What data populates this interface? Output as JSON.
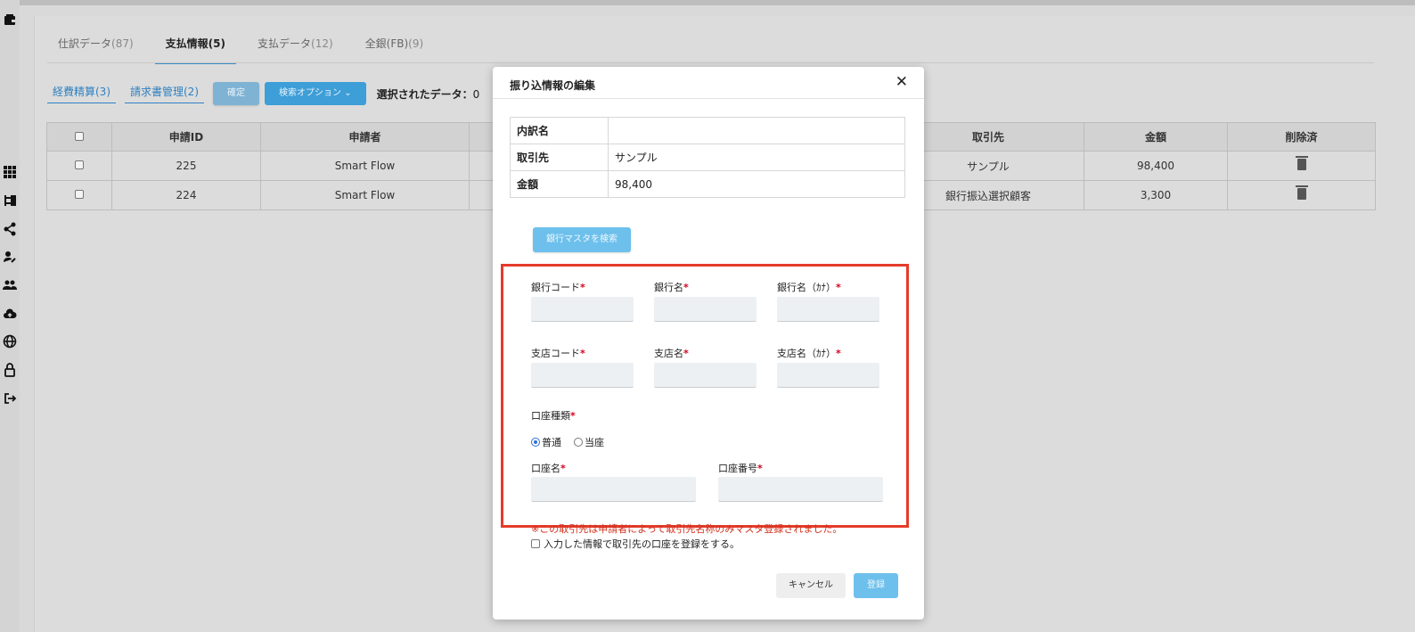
{
  "tabs": [
    {
      "label": "仕訳データ",
      "count": "(87)"
    },
    {
      "label": "支払情報",
      "count": "(5)"
    },
    {
      "label": "支払データ",
      "count": "(12)"
    },
    {
      "label": "全銀(FB)",
      "count": "(9)"
    }
  ],
  "subtabs": [
    "経費精算(3)",
    "請求書管理(2)"
  ],
  "toolbar": {
    "confirm_label": "確定",
    "search_option_label": "検索オプション",
    "selected_label": "選択されたデータ：",
    "selected_count": "0"
  },
  "table": {
    "headers": [
      "申請ID",
      "申請者",
      "取引先",
      "金額",
      "削除済"
    ],
    "rows": [
      {
        "id": "225",
        "applicant": "Smart Flow",
        "partner": "サンプル",
        "amount": "98,400"
      },
      {
        "id": "224",
        "applicant": "Smart Flow",
        "partner": "銀行振込選択顧客",
        "amount": "3,300"
      }
    ]
  },
  "modal": {
    "title": "振り込情報の編集",
    "info": [
      {
        "key": "内訳名",
        "value": ""
      },
      {
        "key": "取引先",
        "value": "サンプル"
      },
      {
        "key": "金額",
        "value": "98,400"
      }
    ],
    "bank_search_label": "銀行マスタを検索",
    "fields": {
      "bank_code": "銀行コード",
      "bank_name": "銀行名",
      "bank_name_kana": "銀行名（ｶﾅ）",
      "branch_code": "支店コード",
      "branch_name": "支店名",
      "branch_name_kana": "支店名（ｶﾅ）",
      "account_type": "口座種類",
      "account_name": "口座名",
      "account_number": "口座番号"
    },
    "required_mark": "*",
    "account_type_options": [
      "普通",
      "当座"
    ],
    "notice": "※この取引先は申請者によって取引先名称のみマスタ登録されました。",
    "register_checkbox_label": "入力した情報で取引先の口座を登録をする。",
    "cancel_label": "キャンセル",
    "submit_label": "登録"
  },
  "colors": {
    "accent": "#3d9ed8",
    "highlight_border": "#e53b2a",
    "required": "#d0021b"
  }
}
